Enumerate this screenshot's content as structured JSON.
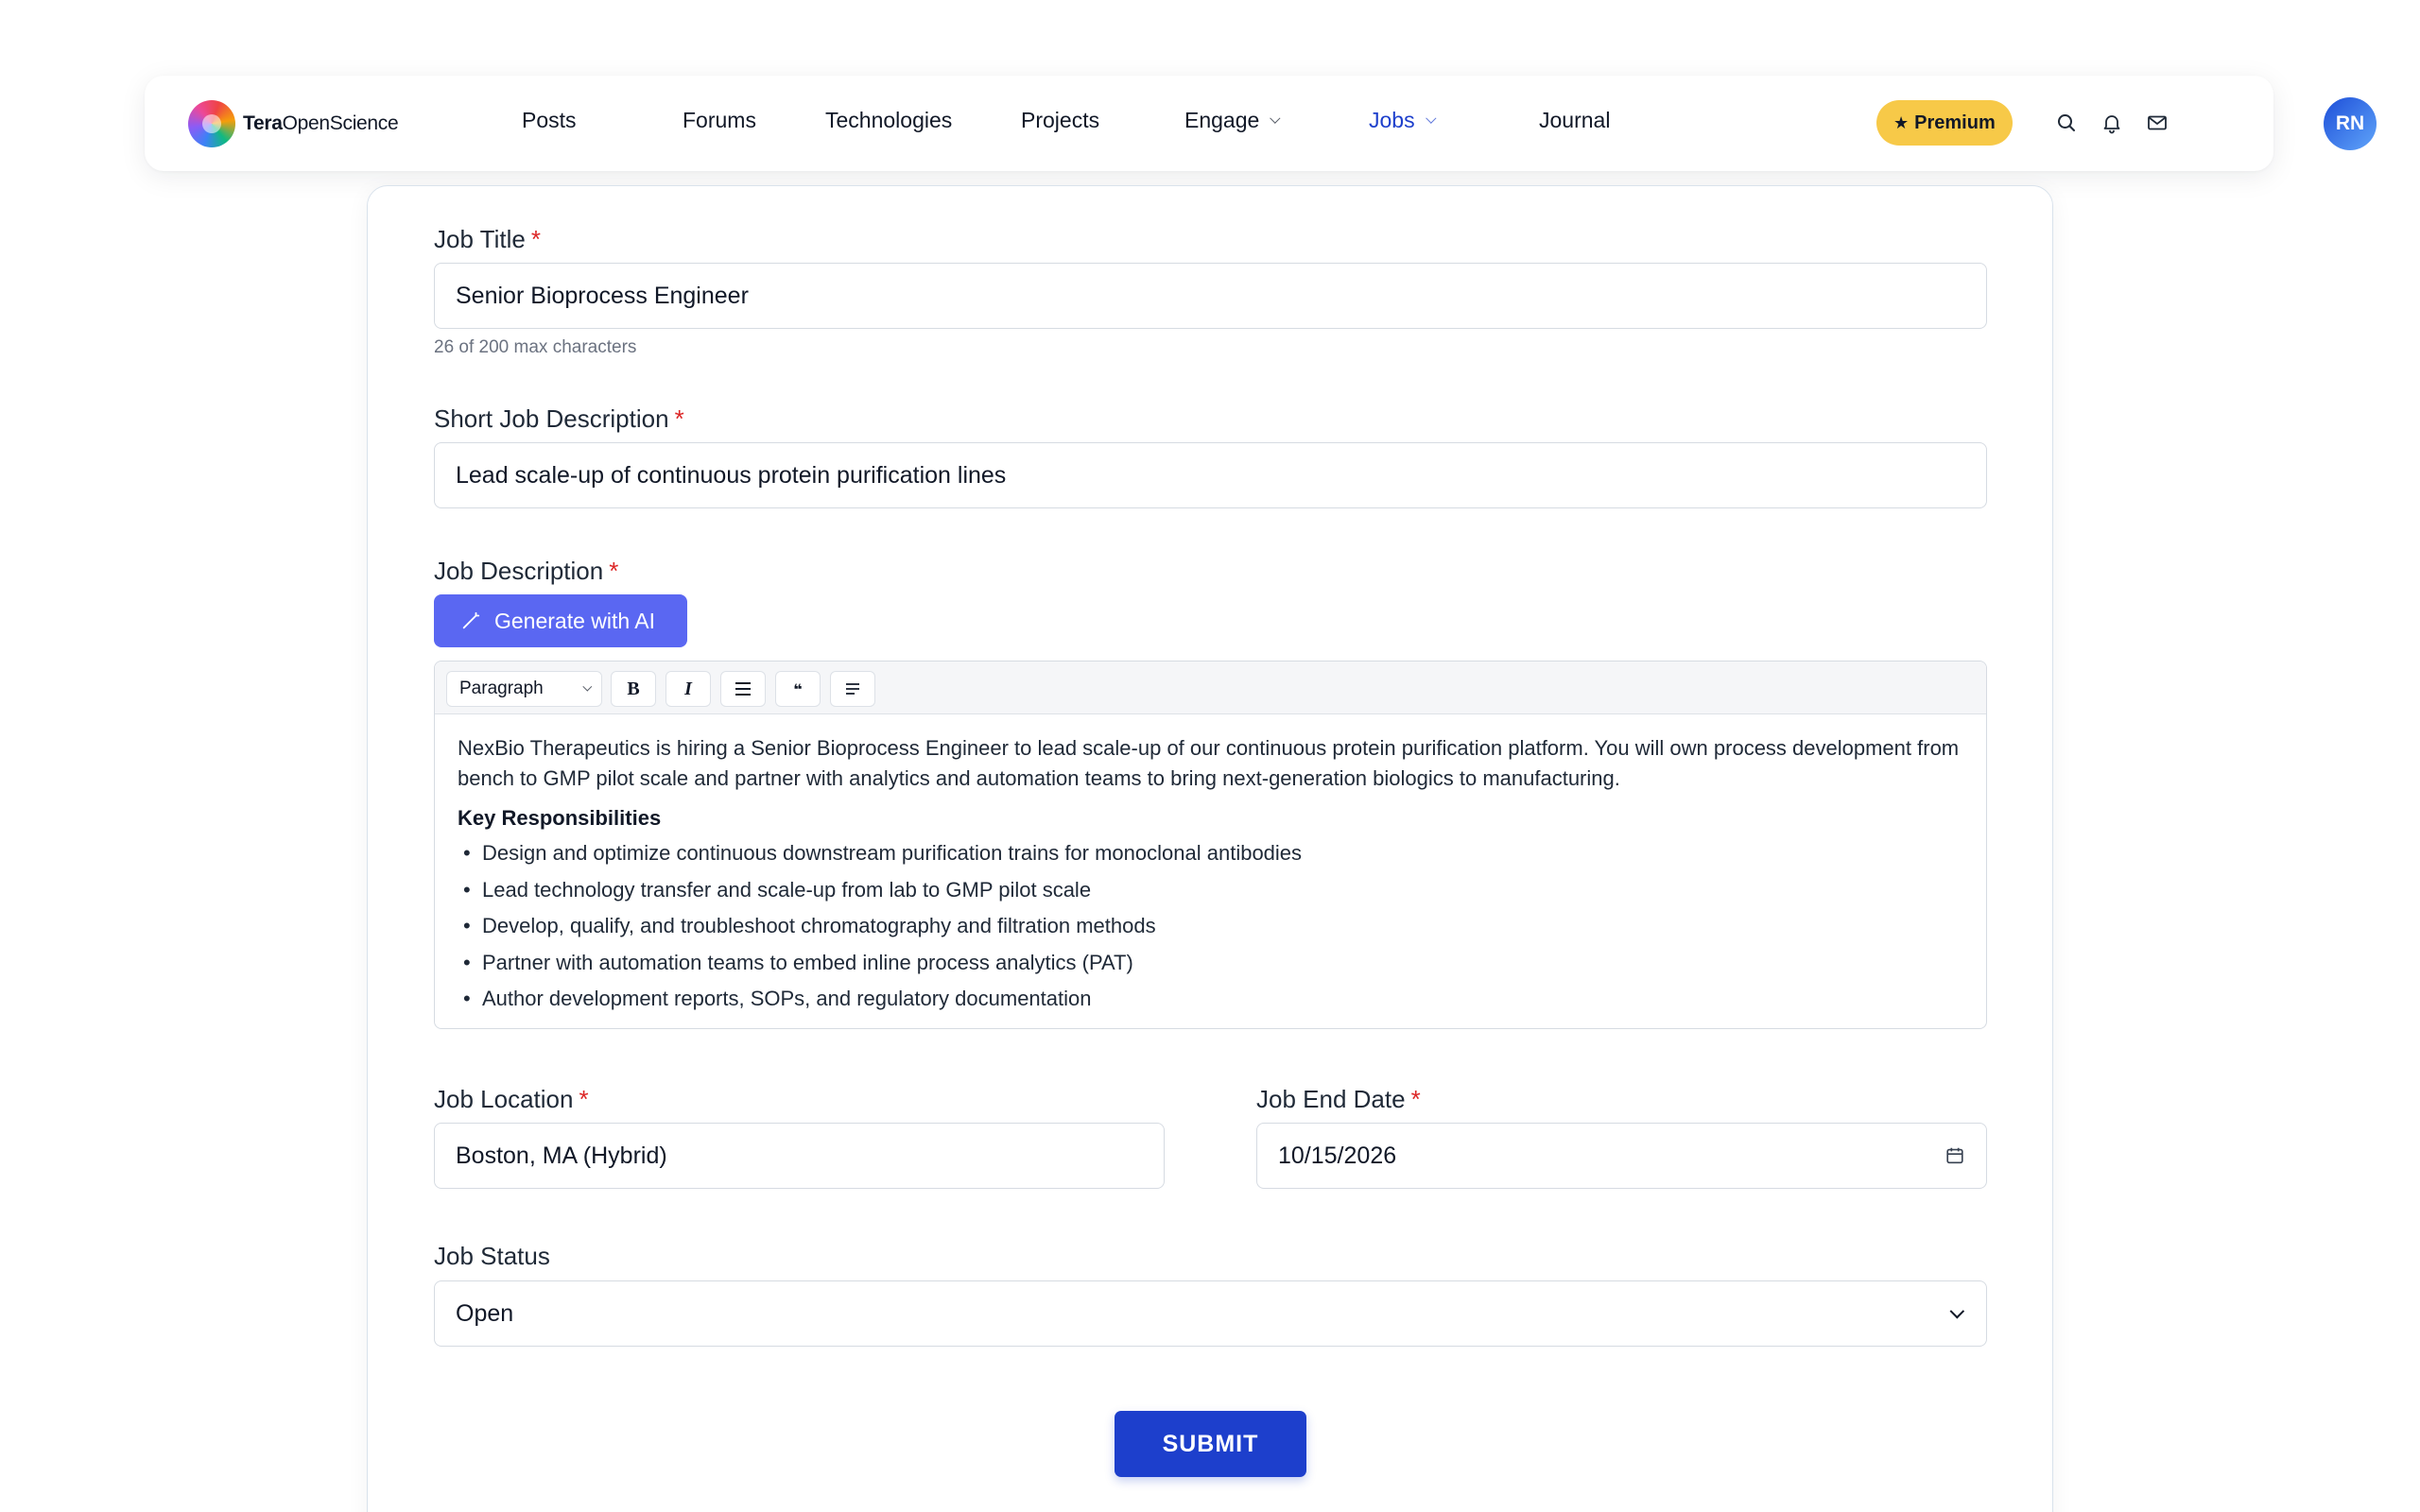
{
  "nav": {
    "logo_bold": "Tera",
    "logo_rest": "OpenScience",
    "links": [
      {
        "label": "Posts"
      },
      {
        "label": "Forums"
      },
      {
        "label": "Technologies"
      },
      {
        "label": "Projects"
      },
      {
        "label": "Engage",
        "dropdown": true
      },
      {
        "label": "Jobs",
        "dropdown": true,
        "active": true
      },
      {
        "label": "Journal"
      }
    ],
    "premium_label": "Premium",
    "premium_icon": "★",
    "icons": [
      "search-icon",
      "bell-icon",
      "mail-icon"
    ],
    "avatar_initials": "RN",
    "colors": {
      "active": "#1d3fcc",
      "premium_bg": "#f7c948",
      "avatar": "#1d4ed8"
    }
  },
  "form": {
    "job_title": {
      "label": "Job Title",
      "required_mark": "*",
      "value": "Senior Bioprocess Engineer",
      "hint": "26 of 200 max characters"
    },
    "short_description": {
      "label": "Short Job Description",
      "required_mark": "*",
      "value": "Lead scale-up of continuous protein purification lines"
    },
    "description": {
      "label": "Job Description",
      "required_mark": "*",
      "ai_button_label": "Generate with AI",
      "toolbar": {
        "block_format": "Paragraph",
        "bold": "B",
        "italic": "I",
        "quote": "❝"
      },
      "intro": "NexBio Therapeutics is hiring a Senior Bioprocess Engineer to lead scale-up of our continuous protein purification platform. You will own process development from bench to GMP pilot scale and partner with analytics and automation teams to bring next-generation biologics to manufacturing.",
      "heading": "Key Responsibilities",
      "bullets": [
        "Design and optimize continuous downstream purification trains for monoclonal antibodies",
        "Lead technology transfer and scale-up from lab to GMP pilot scale",
        "Develop, qualify, and troubleshoot chromatography and filtration methods",
        "Partner with automation teams to embed inline process analytics (PAT)",
        "Author development reports, SOPs, and regulatory documentation"
      ]
    },
    "location": {
      "label": "Job Location",
      "required_mark": "*",
      "value": "Boston, MA (Hybrid)"
    },
    "end_date": {
      "label": "Job End Date",
      "required_mark": "*",
      "value": "10/15/2026"
    },
    "status": {
      "label": "Job Status",
      "value": "Open"
    },
    "submit_label": "SUBMIT",
    "colors": {
      "ai_button": "#5a67f2",
      "submit": "#1d3fcc",
      "required": "#dc2626"
    }
  }
}
